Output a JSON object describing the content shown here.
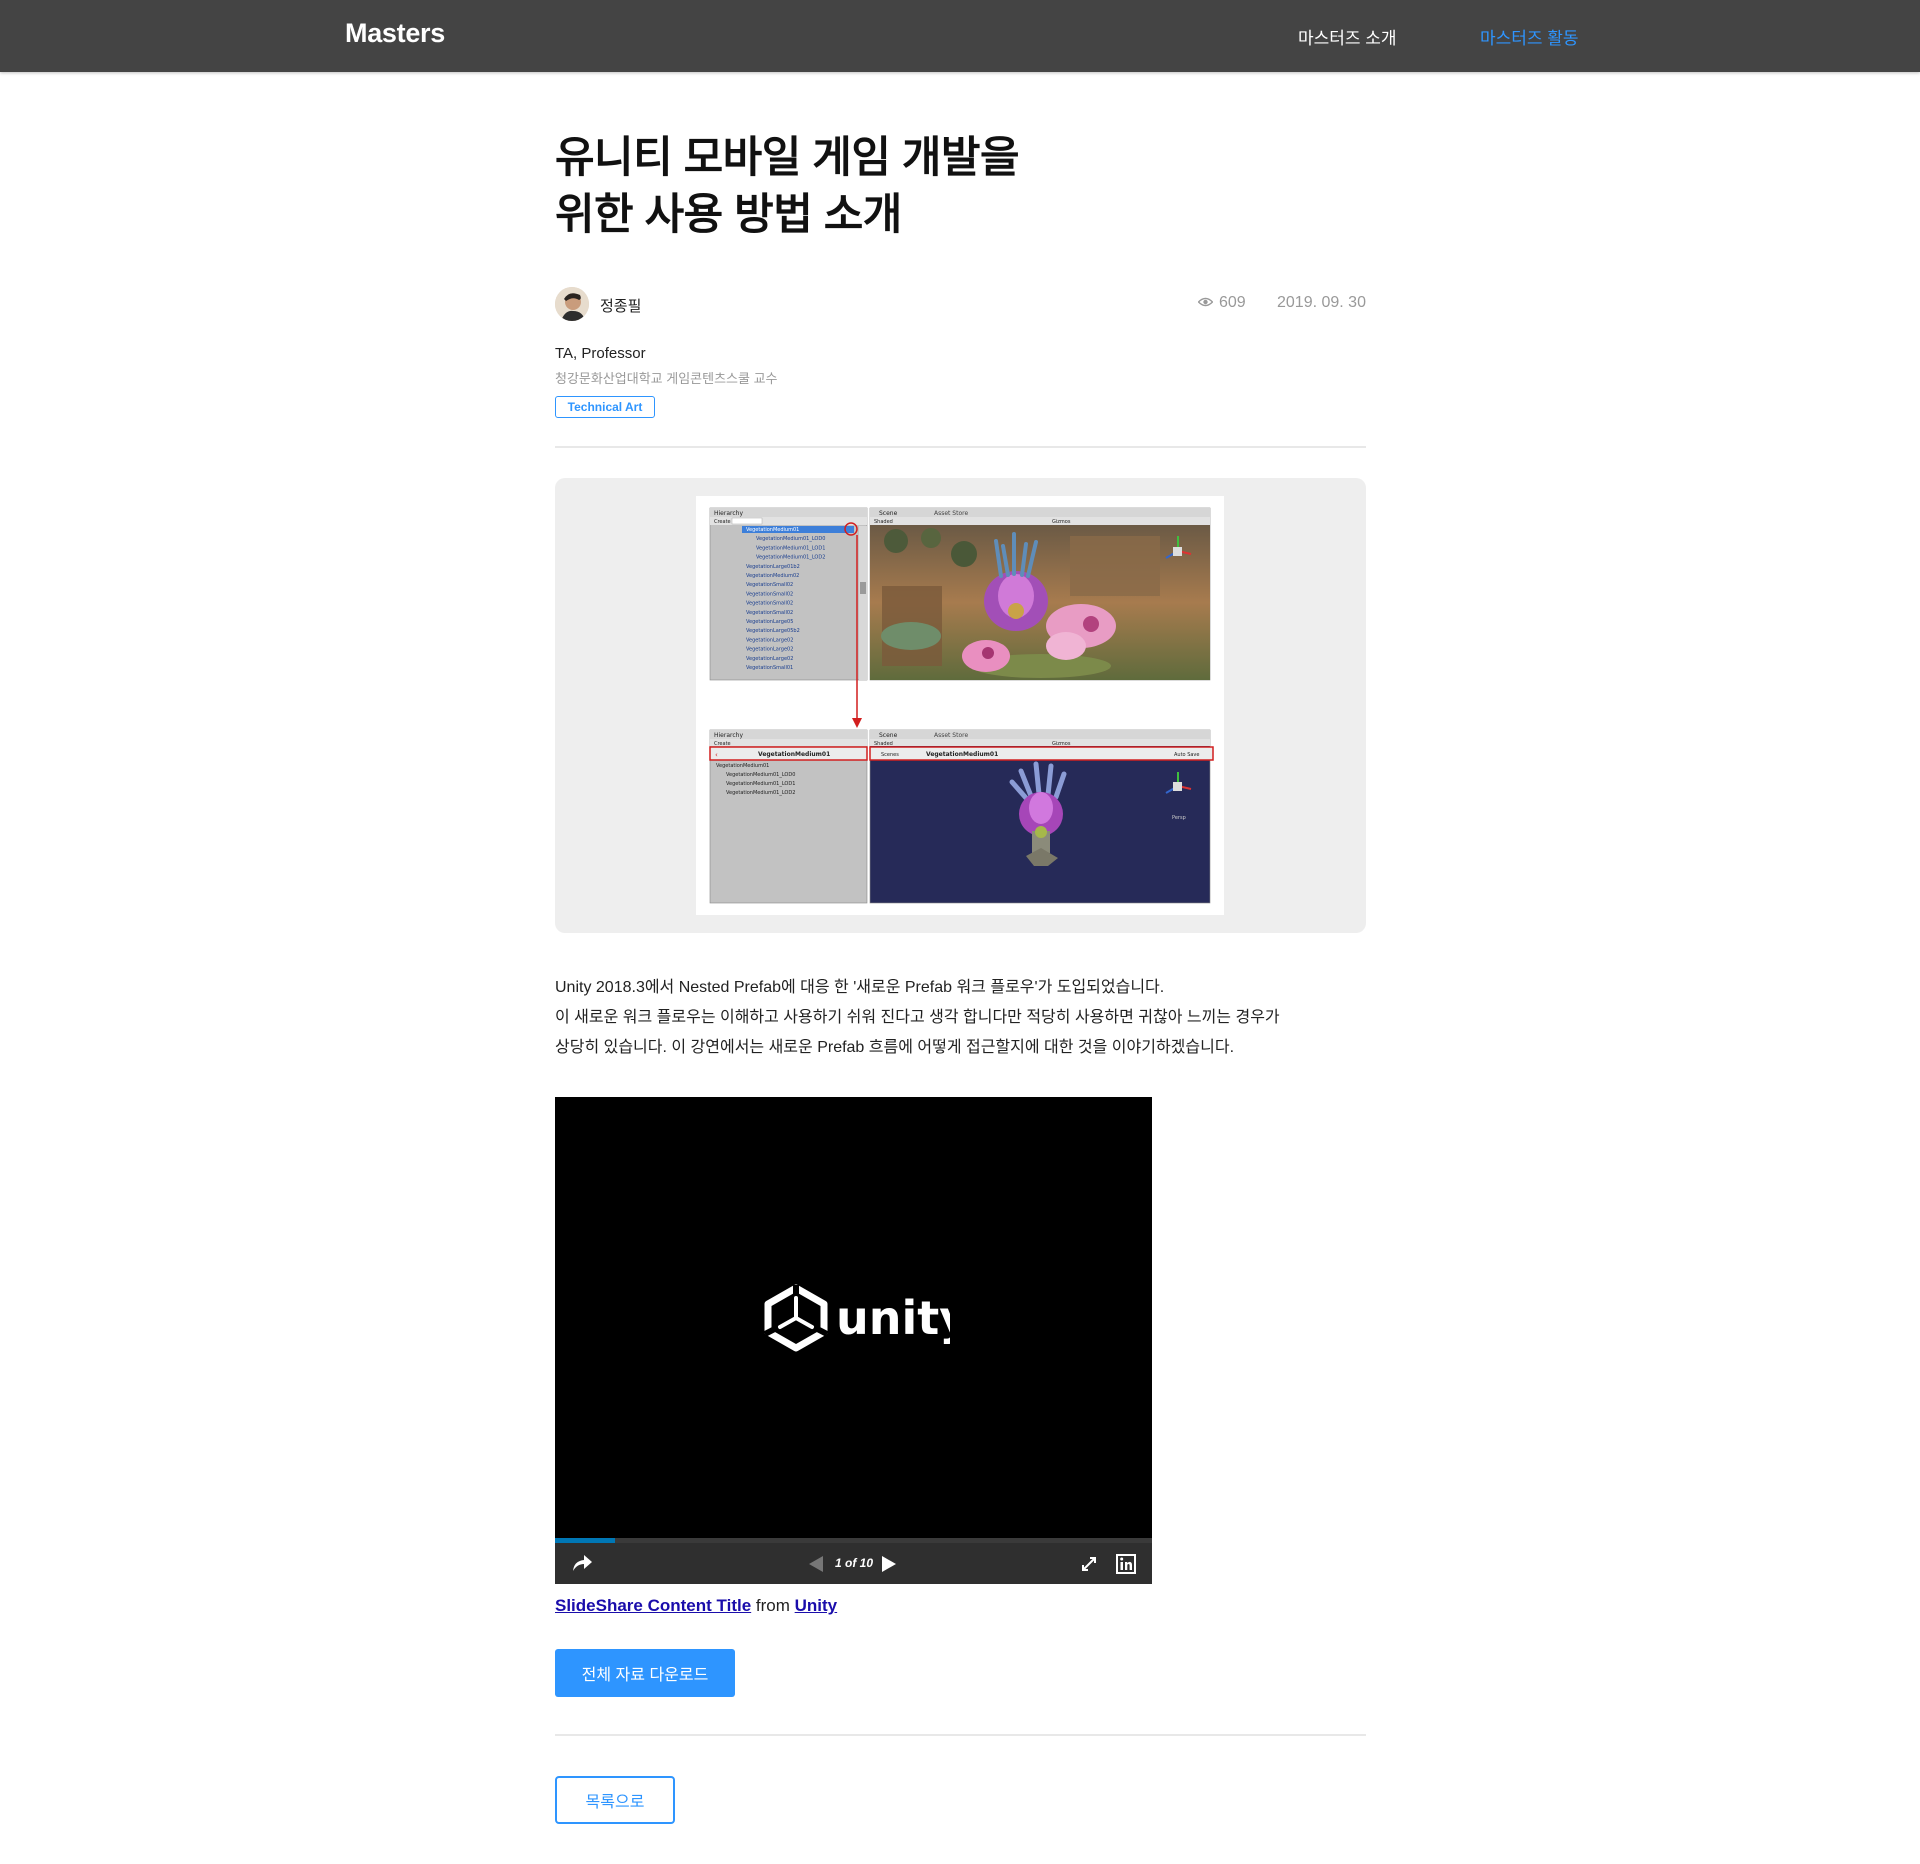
{
  "header": {
    "brand": "Masters",
    "nav": [
      {
        "label": "마스터즈 소개"
      },
      {
        "label": "마스터즈 활동"
      }
    ]
  },
  "article": {
    "title_line1": "유니티 모바일 게임 개발을",
    "title_line2": "위한 사용 방법 소개",
    "author": "정종필",
    "views": "609",
    "date": "2019. 09. 30",
    "role": "TA, Professor",
    "affiliation": "청강문화산업대학교 게임콘텐츠스쿨 교수",
    "tag": "Technical Art",
    "body": [
      "Unity 2018.3에서 Nested Prefab에 대응 한 '새로운 Prefab 워크 플로우'가 도입되었습니다.",
      "이 새로운 워크 플로우는 이해하고 사용하기 쉬워 진다고 생각 합니다만 적당히 사용하면 귀찮아 느끼는 경우가",
      "상당히 있습니다. 이 강연에서는 새로운 Prefab 흐름에 어떻게 접근할지에 대한 것을 이야기하겠습니다."
    ]
  },
  "figure": {
    "top_panel": {
      "hierarchy_tab": "Hierarchy",
      "scene_tab": "Scene",
      "asset_store_tab": "Asset Store",
      "create_label": "Create",
      "shaded_label": "Shaded",
      "gizmos_label": "Gizmos",
      "items": [
        "VegetationMedium01",
        "VegetationMedium01_LOD0",
        "VegetationMedium01_LOD1",
        "VegetationMedium01_LOD2",
        "VegetationLarge01b2",
        "VegetationMedium02",
        "VegetationSmall02",
        "VegetationSmall02",
        "VegetationSmall02",
        "VegetationSmall02",
        "VegetationLarge05",
        "VegetationLarge05b2",
        "VegetationLarge02",
        "VegetationLarge02",
        "VegetationLarge02",
        "VegetationSmall01"
      ]
    },
    "bottom_panel": {
      "hierarchy_tab": "Hierarchy",
      "scene_tab": "Scene",
      "asset_store_tab": "Asset Store",
      "create_label": "Create",
      "shaded_label": "Shaded",
      "gizmos_label": "Gizmos",
      "prefab_name": "VegetationMedium01",
      "scenes_label": "Scenes",
      "auto_save": "Auto Save",
      "persp": "Persp",
      "items": [
        "VegetationMedium01",
        "VegetationMedium01_LOD0",
        "VegetationMedium01_LOD1",
        "VegetationMedium01_LOD2"
      ]
    }
  },
  "embed": {
    "logo_text": "unity",
    "counter": "1 of 10",
    "progress": 0.1
  },
  "caption": {
    "title": "SlideShare Content Title",
    "from": "from",
    "source": "Unity"
  },
  "buttons": {
    "download": "전체 자료 다운로드",
    "back": "목록으로"
  },
  "colors": {
    "header_bg": "#444444",
    "accent": "#2e95ff",
    "link": "#1a0dab"
  }
}
